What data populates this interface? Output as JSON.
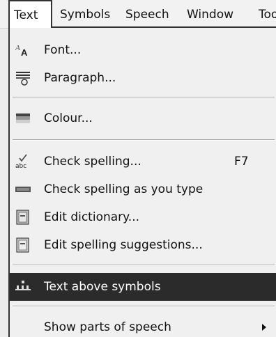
{
  "menubar": {
    "items": [
      "Text",
      "Symbols",
      "Speech",
      "Window",
      "Too"
    ]
  },
  "menu": {
    "items": [
      {
        "label": "Font...",
        "icon": "font-icon"
      },
      {
        "label": "Paragraph...",
        "icon": "paragraph-icon"
      },
      {
        "label": "Colour...",
        "icon": "colour-icon"
      },
      {
        "label": "Check spelling...",
        "shortcut": "F7",
        "icon": "check-spelling-icon"
      },
      {
        "label": "Check spelling as you type",
        "icon": "spelling-as-you-type-icon"
      },
      {
        "label": "Edit dictionary...",
        "icon": "edit-dictionary-icon"
      },
      {
        "label": "Edit spelling suggestions...",
        "icon": "edit-suggestions-icon"
      },
      {
        "label": "Text above symbols",
        "icon": "text-above-symbols-icon",
        "highlighted": true
      },
      {
        "label": "Show parts of speech",
        "submenu": true
      }
    ]
  },
  "colors": {
    "highlight_bg": "#2b2b2b",
    "highlight_text": "#ffffff",
    "menu_bg": "#f0f0f0"
  }
}
